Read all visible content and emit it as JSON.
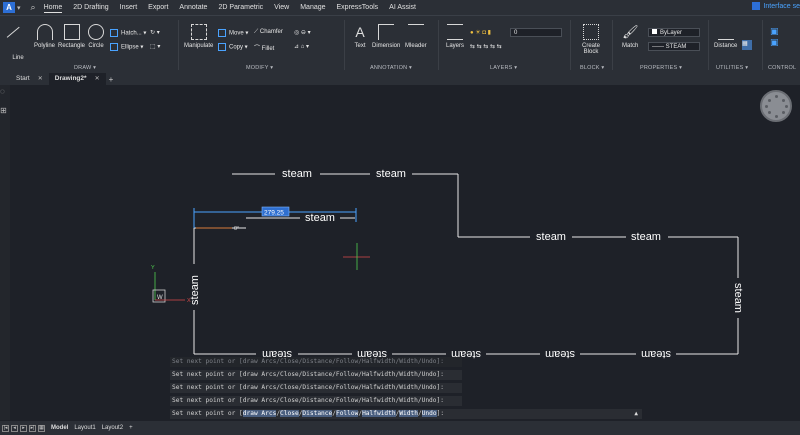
{
  "app": {
    "logo_letter": "A",
    "search_icon": "search-icon",
    "interface_label": "Interface se"
  },
  "menu": {
    "items": [
      "Home",
      "2D Drafting",
      "Insert",
      "Export",
      "Annotate",
      "2D Parametric",
      "View",
      "Manage",
      "ExpressTools",
      "AI Assist"
    ],
    "active": "Home"
  },
  "ribbon": {
    "draw": {
      "label": "DRAW",
      "tools": [
        "Line",
        "Polyline",
        "Rectangle",
        "Circle"
      ],
      "hatch": "Hatch...",
      "ellipse": "Ellipse"
    },
    "modify": {
      "label": "MODIFY",
      "manipulate": "Manipulate",
      "move": "Move",
      "copy": "Copy",
      "chamfer": "Chamfer",
      "fillet": "Fillet"
    },
    "annotation": {
      "label": "ANNOTATION",
      "text": "Text",
      "dimension": "Dimension",
      "mleader": "Mleader"
    },
    "layers": {
      "label": "LAYERS",
      "layers": "Layers",
      "current_layer": "0"
    },
    "block": {
      "label": "BLOCK",
      "create": "Create",
      "block": "Block"
    },
    "properties": {
      "label": "PROPERTIES",
      "match": "Match",
      "color": "ByLayer",
      "linetype": "STEAM"
    },
    "utilities": {
      "label": "UTILITIES",
      "distance": "Distance"
    },
    "control": {
      "label": "CONTROL"
    }
  },
  "tabs": [
    {
      "label": "Start",
      "active": false
    },
    {
      "label": "Drawing2*",
      "active": true
    }
  ],
  "drawing": {
    "labels": [
      "steam",
      "steam",
      "steam",
      "steam",
      "steam",
      "steam",
      "steam",
      "steam",
      "steam",
      "steam",
      "steam",
      "steam",
      "steam"
    ],
    "dim_value": "279.25",
    "angle": "0°",
    "ucs": {
      "x": "X",
      "y": "Y",
      "w": "W"
    }
  },
  "commands": {
    "history": [
      "Set next point or [draw Arcs/Close/Distance/Follow/Halfwidth/Width/Undo]:",
      "Set next point or [draw Arcs/Close/Distance/Follow/Halfwidth/Width/Undo]:",
      "Set next point or [draw Arcs/Close/Distance/Follow/Halfwidth/Width/Undo]:",
      "Set next point or [draw Arcs/Close/Distance/Follow/Halfwidth/Width/Undo]:"
    ],
    "prompt": "Set next point or [",
    "options": [
      "draw Arcs",
      "Close",
      "Distance",
      "Follow",
      "Halfwidth",
      "Width",
      "Undo"
    ],
    "suffix": "]:"
  },
  "layout_tabs": {
    "model": "Model",
    "layout1": "Layout1",
    "layout2": "Layout2"
  }
}
